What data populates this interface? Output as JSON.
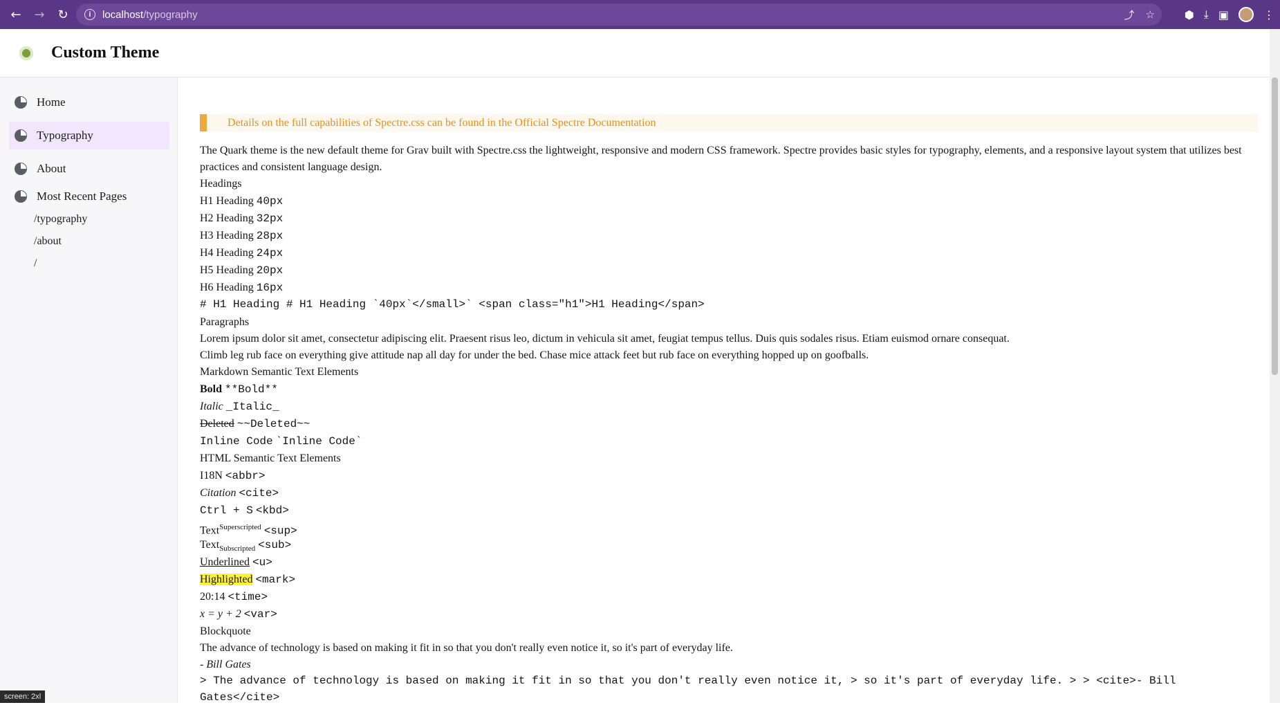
{
  "browser": {
    "url_host": "localhost",
    "url_path": "/typography",
    "back_icon": "←",
    "forward_icon": "→",
    "reload_icon": "↻",
    "share_icon": "⤴",
    "star_icon": "☆",
    "extensions_icon": "⬢",
    "download_icon": "⤓",
    "sidepanel_icon": "▣",
    "menu_icon": "⋮"
  },
  "site": {
    "title": "Custom Theme"
  },
  "sidebar": {
    "items": [
      {
        "label": "Home"
      },
      {
        "label": "Typography"
      },
      {
        "label": "About"
      },
      {
        "label": "Most Recent Pages"
      }
    ],
    "recent": [
      "/typography",
      "/about",
      "/"
    ]
  },
  "content": {
    "toast": "Details on the full capabilities of Spectre.css can be found in the Official Spectre Documentation",
    "intro_line1": "The Quark theme is the new default theme for Grav built with Spectre.css the lightweight, responsive and modern CSS framework. Spectre provides basic styles for typography, elements, and a responsive layout system that utilizes best",
    "intro_line2": "practices and consistent language design.",
    "headings_title": "Headings",
    "headings": [
      {
        "text": "H1 Heading",
        "size": "40px"
      },
      {
        "text": "H2 Heading",
        "size": "32px"
      },
      {
        "text": "H3 Heading",
        "size": "28px"
      },
      {
        "text": "H4 Heading",
        "size": "24px"
      },
      {
        "text": "H5 Heading",
        "size": "20px"
      },
      {
        "text": "H6 Heading",
        "size": "16px"
      }
    ],
    "heading_code": "# H1 Heading # H1 Heading `40px`</small>` <span class=\"h1\">H1 Heading</span>",
    "paragraphs_title": "Paragraphs",
    "paragraph1": "Lorem ipsum dolor sit amet, consectetur adipiscing elit. Praesent risus leo, dictum in vehicula sit amet, feugiat tempus tellus. Duis quis sodales risus. Etiam euismod ornare consequat.",
    "paragraph2": "Climb leg rub face on everything give attitude nap all day for under the bed. Chase mice attack feet but rub face on everything hopped up on goofballs.",
    "markdown_title": "Markdown Semantic Text Elements",
    "bold": "Bold",
    "bold_code": "**Bold**",
    "italic": "Italic",
    "italic_code": "_Italic_",
    "deleted": "Deleted",
    "deleted_code": "~~Deleted~~",
    "inline_code": "Inline Code",
    "inline_code_code": "`Inline Code`",
    "html_title": "HTML Semantic Text Elements",
    "abbr": "I18N",
    "abbr_code": "<abbr>",
    "cite": "Citation",
    "cite_code": "<cite>",
    "kbd": "Ctrl + S",
    "kbd_code": "<kbd>",
    "sup_base": "Text",
    "sup": "Superscripted",
    "sup_code": "<sup>",
    "sub_base": "Text",
    "sub": "Subscripted",
    "sub_code": "<sub>",
    "underlined": "Underlined",
    "underlined_code": "<u>",
    "highlighted": "Highlighted",
    "highlighted_code": "<mark>",
    "time": "20:14",
    "time_code": "<time>",
    "var": "x = y + 2",
    "var_code": "<var>",
    "blockquote_title": "Blockquote",
    "quote": "The advance of technology is based on making it fit in so that you don't really even notice it, so it's part of everyday life.",
    "quote_author": "- Bill Gates",
    "quote_code_line1": "> The advance of technology is based on making it fit in so that you don't really even notice it, > so it's part of everyday life. > > <cite>- Bill",
    "quote_code_line2": "Gates</cite>"
  },
  "status": {
    "screen": "screen: 2xl"
  }
}
